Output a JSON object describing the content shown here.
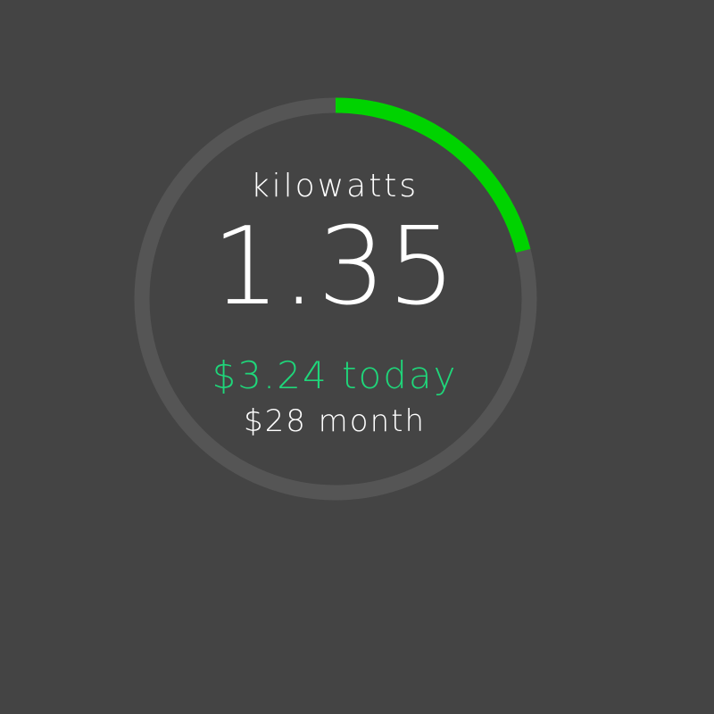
{
  "gauge": {
    "unit_label": "kilowatts",
    "value": "1.35",
    "progress_fraction": 0.21,
    "today_cost": "$3.24 today",
    "month_cost": "$28 month"
  },
  "colors": {
    "background": "#444444",
    "track": "#555555",
    "progress": "#00d300",
    "primary_text": "#ffffff",
    "accent_text": "#1fd67a"
  }
}
